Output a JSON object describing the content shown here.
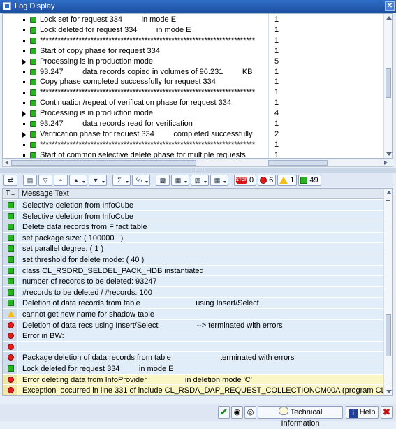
{
  "window": {
    "title": "Log Display",
    "close_label": "✕"
  },
  "upper_rows": [
    {
      "marker": "bullet",
      "text": "Lock set for request 334         in mode E",
      "count": "1"
    },
    {
      "marker": "bullet",
      "text": "Lock deleted for request 334         in mode E",
      "count": "1"
    },
    {
      "marker": "bullet",
      "text": "************************************************************************",
      "count": "1"
    },
    {
      "marker": "bullet",
      "text": "Start of copy phase for request 334",
      "count": "1"
    },
    {
      "marker": "caret",
      "text": "Processing is in production mode",
      "count": "5"
    },
    {
      "marker": "bullet",
      "text": "93.247         data records copied in volumes of 96.231         KB",
      "count": "1"
    },
    {
      "marker": "bullet",
      "text": "Copy phase completed successfully for request 334",
      "count": "1"
    },
    {
      "marker": "bullet",
      "text": "************************************************************************",
      "count": "1"
    },
    {
      "marker": "bullet",
      "text": "Continuation/repeat of verification phase for request 334",
      "count": "1"
    },
    {
      "marker": "caret",
      "text": "Processing is in production mode",
      "count": "4"
    },
    {
      "marker": "bullet",
      "text": "93.247         data records read for verification",
      "count": "1"
    },
    {
      "marker": "caret",
      "text": "Verification phase for request 334         completed successfully",
      "count": "2"
    },
    {
      "marker": "bullet",
      "text": "************************************************************************",
      "count": "1"
    },
    {
      "marker": "bullet",
      "text": "Start of common selective delete phase for multiple requests",
      "count": "1"
    }
  ],
  "toolbar": {
    "stop_count": "0",
    "error_count": "6",
    "warning_count": "1",
    "success_count": "49",
    "stop_label": "STOP"
  },
  "lower": {
    "col_type": "T...",
    "col_message": "Message Text",
    "rows": [
      {
        "type": "green",
        "text": "Selective deletion from InfoCube"
      },
      {
        "type": "green",
        "text": "Selective deletion from InfoCube"
      },
      {
        "type": "green",
        "text": "Delete data records from F fact table"
      },
      {
        "type": "green",
        "text": "set package size: ( 100000   )"
      },
      {
        "type": "green",
        "text": "set parallel degree: ( 1 )"
      },
      {
        "type": "green",
        "text": "set threshold for delete mode: ( 40 )"
      },
      {
        "type": "green",
        "text": "class CL_RSDRD_SELDEL_PACK_HDB instantiated"
      },
      {
        "type": "green",
        "text": "number of records to be deleted: 93247"
      },
      {
        "type": "green",
        "text": "#records to be deleted / #records: 100"
      },
      {
        "type": "green",
        "text": "Deletion of data records from table                          using Insert/Select"
      },
      {
        "type": "yellow",
        "text": "cannot get new name for shadow table"
      },
      {
        "type": "red",
        "text": "Deletion of data recs using Insert/Select                  --> terminated with errors"
      },
      {
        "type": "red",
        "text": "Error in BW:"
      },
      {
        "type": "red",
        "text": ""
      },
      {
        "type": "red",
        "text": "Package deletion of data records from table                       terminated with errors"
      },
      {
        "type": "green",
        "text": "Lock deleted for request 334         in mode E"
      },
      {
        "type": "red",
        "text": "Error deleting data from InfoProvider                  in deletion mode 'C'",
        "highlight": true
      },
      {
        "type": "red",
        "text": "Exception  occurred in line 331 of include CL_RSDA_DAP_REQUEST_COLLECTIONCM00A (program CL_RSD...",
        "highlight": true
      }
    ]
  },
  "bottom": {
    "technical_info_label": "Technical Information",
    "help_label": "Help"
  }
}
